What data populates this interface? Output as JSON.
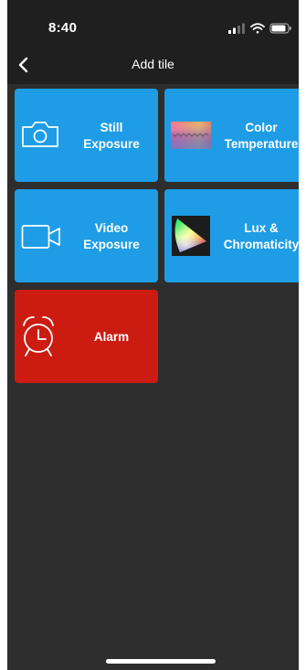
{
  "status_bar": {
    "time": "8:40"
  },
  "nav": {
    "title": "Add tile",
    "back_icon": "chevron-left-icon"
  },
  "tiles": [
    {
      "line1": "Still",
      "line2": "Exposure",
      "icon": "camera-icon",
      "color": "#1e9de6"
    },
    {
      "line1": "Color",
      "line2": "Temperature",
      "icon": "color-spectrum-icon",
      "color": "#1e9de6"
    },
    {
      "line1": "Video",
      "line2": "Exposure",
      "icon": "video-camera-icon",
      "color": "#1e9de6"
    },
    {
      "line1": "Lux &",
      "line2": "Chromaticity",
      "icon": "chromaticity-diagram-icon",
      "color": "#1e9de6"
    },
    {
      "line1": "Alarm",
      "line2": "",
      "icon": "alarm-clock-icon",
      "color": "#cc1c12"
    }
  ],
  "colors": {
    "background": "#2e2e2e",
    "header": "#1f1f1f",
    "tile_blue": "#1e9de6",
    "tile_red": "#cc1c12"
  }
}
